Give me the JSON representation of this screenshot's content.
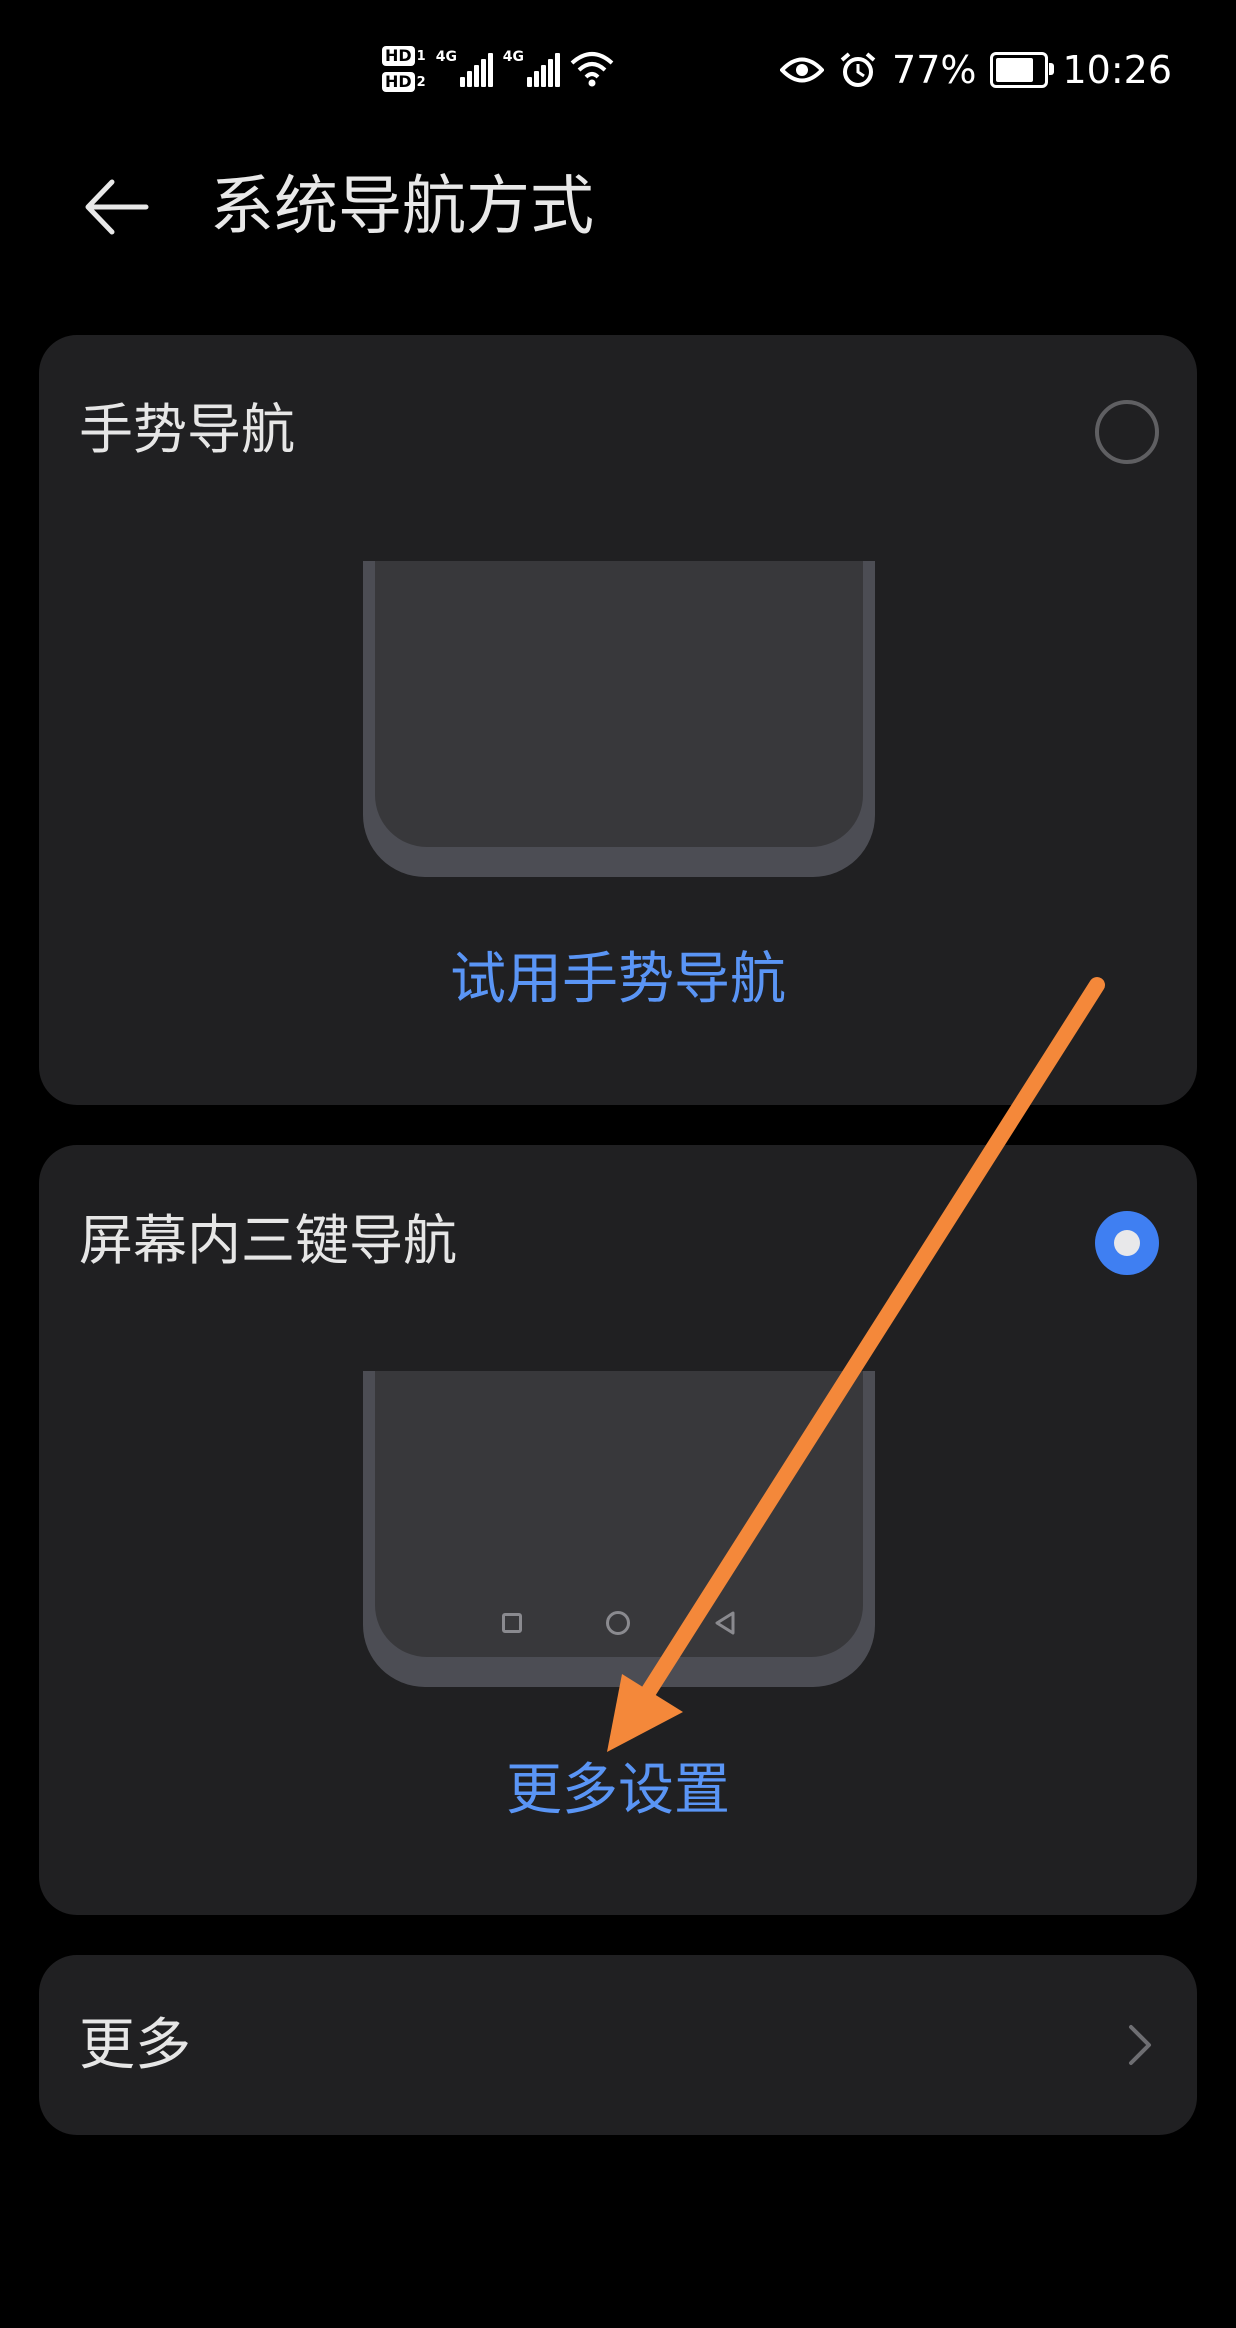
{
  "status_bar": {
    "hd1_label": "HD",
    "hd1_sim": "1",
    "hd2_label": "HD",
    "hd2_sim": "2",
    "network1": "4G",
    "network2": "4G",
    "battery_percent": "77%",
    "time": "10:26",
    "icons": [
      "hd-icon",
      "signal-icon",
      "wifi-icon",
      "eye-comfort-icon",
      "alarm-icon",
      "battery-icon"
    ]
  },
  "header": {
    "title": "系统导航方式",
    "back_icon": "back-arrow-icon"
  },
  "options": [
    {
      "title": "手势导航",
      "selected": false,
      "action_label": "试用手势导航"
    },
    {
      "title": "屏幕内三键导航",
      "selected": true,
      "action_label": "更多设置",
      "nav_icons": [
        "recent-apps-icon",
        "home-icon",
        "back-icon"
      ]
    }
  ],
  "more": {
    "label": "更多",
    "icon": "chevron-right-icon"
  },
  "colors": {
    "background": "#000000",
    "card": "#202022",
    "accent": "#3f7ff2",
    "link": "#5a95f5",
    "annotation_arrow": "#f4883a"
  }
}
